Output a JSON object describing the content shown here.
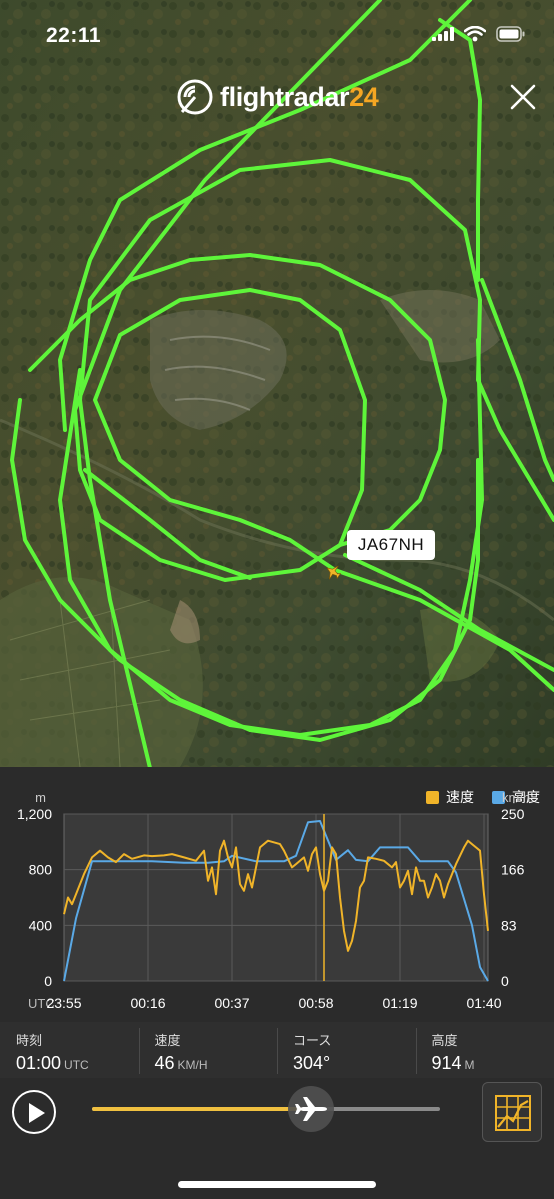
{
  "status_bar": {
    "time": "22:11"
  },
  "app": {
    "logo_text": "flightradar",
    "logo_number": "24"
  },
  "map": {
    "aircraft_registration": "JA67NH",
    "track_color": "#5ef53a"
  },
  "legend": {
    "speed_label": "速度",
    "speed_color": "#f0b429",
    "altitude_label": "高度",
    "altitude_color": "#5aa9e6"
  },
  "chart_data": {
    "type": "line",
    "left_axis_unit": "m",
    "right_axis_unit": "km/h",
    "x_unit_label": "UTC",
    "left_ticks": [
      "1,200",
      "800",
      "400",
      "0"
    ],
    "right_ticks": [
      "250",
      "166",
      "83",
      "0"
    ],
    "x_ticks": [
      "23:55",
      "00:16",
      "00:37",
      "00:58",
      "01:19",
      "01:40"
    ],
    "ylim_altitude": [
      0,
      1200
    ],
    "ylim_speed": [
      0,
      250
    ],
    "x_minutes_since_2355": [
      0,
      106
    ],
    "cursor_time": "01:00",
    "series": [
      {
        "name": "高度",
        "color": "#5aa9e6",
        "points": [
          [
            0,
            0
          ],
          [
            3,
            450
          ],
          [
            7,
            860
          ],
          [
            22,
            860
          ],
          [
            30,
            850
          ],
          [
            36,
            850
          ],
          [
            40,
            860
          ],
          [
            42,
            900
          ],
          [
            48,
            860
          ],
          [
            55,
            860
          ],
          [
            58,
            900
          ],
          [
            61,
            1140
          ],
          [
            64,
            1150
          ],
          [
            65,
            1080
          ],
          [
            68,
            870
          ],
          [
            71,
            940
          ],
          [
            73,
            870
          ],
          [
            76,
            860
          ],
          [
            79,
            960
          ],
          [
            86,
            960
          ],
          [
            89,
            860
          ],
          [
            96,
            860
          ],
          [
            98,
            780
          ],
          [
            102,
            400
          ],
          [
            104,
            100
          ],
          [
            106,
            0
          ]
        ]
      },
      {
        "name": "速度",
        "color": "#f0b429",
        "points": [
          [
            0,
            100
          ],
          [
            1,
            125
          ],
          [
            2,
            115
          ],
          [
            3,
            130
          ],
          [
            5,
            160
          ],
          [
            7,
            185
          ],
          [
            9,
            195
          ],
          [
            11,
            185
          ],
          [
            13,
            178
          ],
          [
            15,
            190
          ],
          [
            17,
            183
          ],
          [
            20,
            188
          ],
          [
            22,
            187
          ],
          [
            25,
            188
          ],
          [
            27,
            190
          ],
          [
            30,
            185
          ],
          [
            33,
            180
          ],
          [
            35,
            195
          ],
          [
            36,
            150
          ],
          [
            37,
            170
          ],
          [
            38,
            130
          ],
          [
            39,
            195
          ],
          [
            40,
            210
          ],
          [
            41,
            185
          ],
          [
            42,
            170
          ],
          [
            43,
            200
          ],
          [
            44,
            145
          ],
          [
            45,
            135
          ],
          [
            46,
            160
          ],
          [
            47,
            140
          ],
          [
            48,
            170
          ],
          [
            49,
            200
          ],
          [
            51,
            210
          ],
          [
            54,
            205
          ],
          [
            55,
            195
          ],
          [
            57,
            170
          ],
          [
            58,
            175
          ],
          [
            60,
            185
          ],
          [
            61,
            165
          ],
          [
            62,
            190
          ],
          [
            63,
            200
          ],
          [
            64,
            160
          ],
          [
            65,
            135
          ],
          [
            66,
            150
          ],
          [
            67,
            200
          ],
          [
            68,
            190
          ],
          [
            69,
            125
          ],
          [
            70,
            75
          ],
          [
            71,
            45
          ],
          [
            72,
            60
          ],
          [
            73,
            90
          ],
          [
            74,
            140
          ],
          [
            75,
            150
          ],
          [
            76,
            185
          ],
          [
            78,
            183
          ],
          [
            80,
            180
          ],
          [
            82,
            170
          ],
          [
            83,
            178
          ],
          [
            84,
            140
          ],
          [
            85,
            150
          ],
          [
            86,
            165
          ],
          [
            87,
            130
          ],
          [
            88,
            170
          ],
          [
            89,
            150
          ],
          [
            90,
            150
          ],
          [
            91,
            125
          ],
          [
            92,
            140
          ],
          [
            93,
            160
          ],
          [
            94,
            150
          ],
          [
            95,
            125
          ],
          [
            96,
            145
          ],
          [
            97,
            160
          ],
          [
            98,
            175
          ],
          [
            100,
            200
          ],
          [
            101,
            210
          ],
          [
            102,
            205
          ],
          [
            103,
            200
          ],
          [
            104,
            195
          ],
          [
            105,
            130
          ],
          [
            106,
            75
          ]
        ]
      }
    ]
  },
  "info": {
    "time_label": "時刻",
    "time_value": "01:00",
    "time_unit": "UTC",
    "speed_label": "速度",
    "speed_value": "46",
    "speed_unit": "KM/H",
    "course_label": "コース",
    "course_value": "304°",
    "altitude_label": "高度",
    "altitude_value": "914",
    "altitude_unit": "M"
  },
  "playback": {
    "progress": 0.63
  },
  "icons": {
    "play": "play-icon",
    "airplane": "airplane-icon",
    "chart": "chart-toggle-icon",
    "close": "close-icon",
    "logo": "radar-logo-icon",
    "signal": "cellular-signal-icon",
    "wifi": "wifi-icon",
    "battery": "battery-icon"
  }
}
